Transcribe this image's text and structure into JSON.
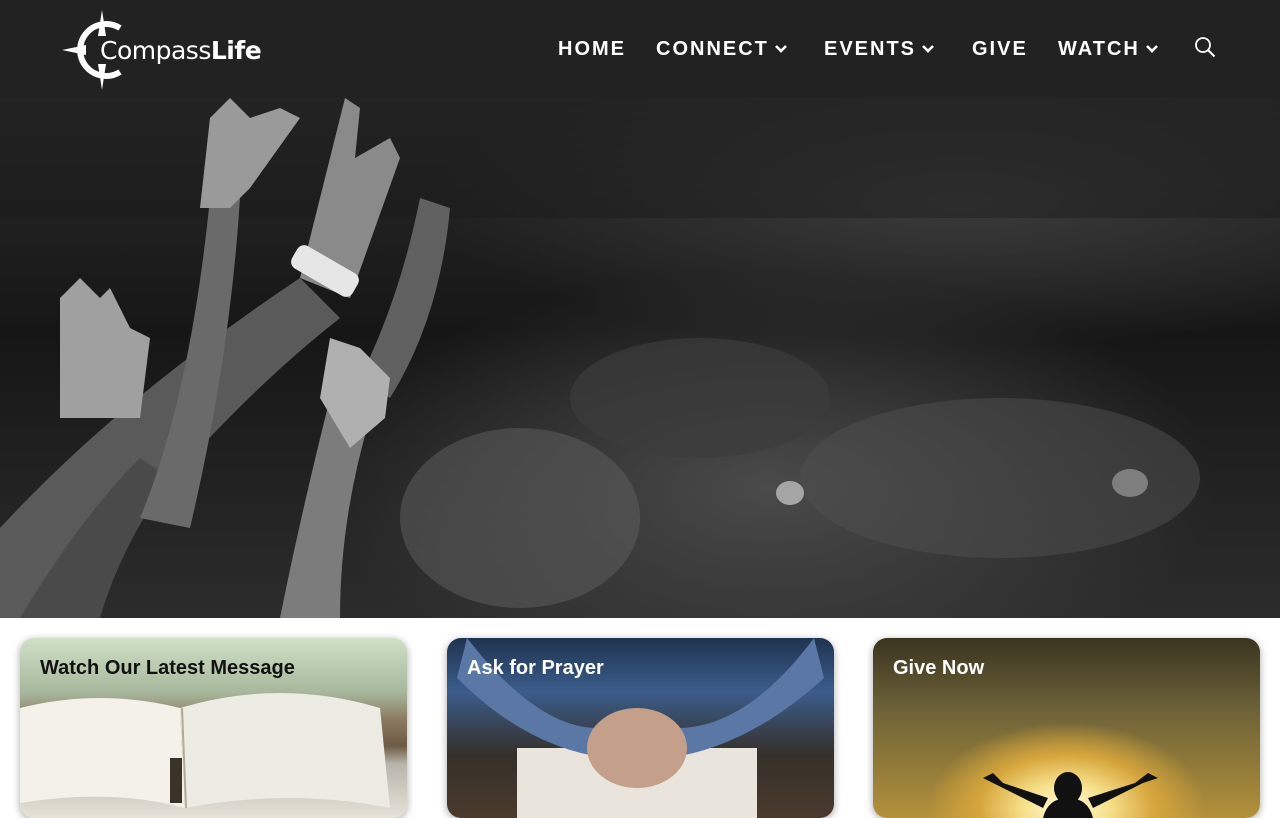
{
  "brand": {
    "name_light": "Compass",
    "name_bold": "Life"
  },
  "nav": {
    "home": "HOME",
    "connect": "CONNECT",
    "events": "EVENTS",
    "give": "GIVE",
    "watch": "WATCH",
    "search_icon": "search-icon",
    "chevron_icon": "chevron-down-icon"
  },
  "cards": [
    {
      "title": "Watch Our Latest Message"
    },
    {
      "title": "Ask for Prayer"
    },
    {
      "title": "Give Now"
    }
  ],
  "colors": {
    "header_bg": "#222222",
    "nav_text": "#ffffff"
  }
}
